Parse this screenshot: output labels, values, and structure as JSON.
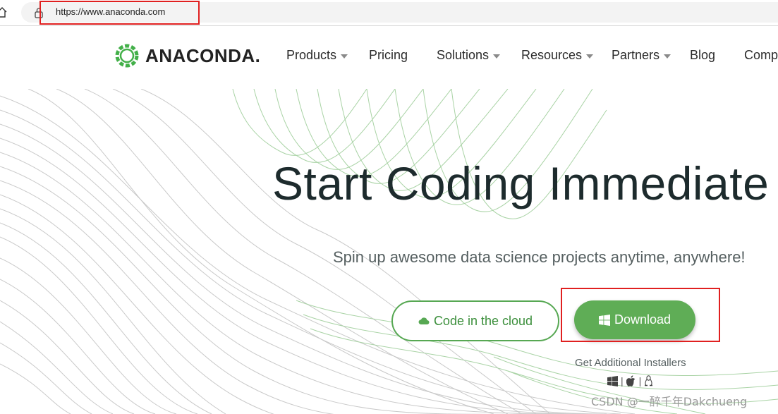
{
  "browser": {
    "url": "https://www.anaconda.com"
  },
  "nav": {
    "logo_text": "ANACONDA.",
    "items": [
      {
        "label": "Products",
        "has_dropdown": true
      },
      {
        "label": "Pricing",
        "has_dropdown": false
      },
      {
        "label": "Solutions",
        "has_dropdown": true
      },
      {
        "label": "Resources",
        "has_dropdown": true
      },
      {
        "label": "Partners",
        "has_dropdown": true
      },
      {
        "label": "Blog",
        "has_dropdown": false
      },
      {
        "label": "Comp",
        "has_dropdown": false
      }
    ]
  },
  "hero": {
    "title": "Start Coding Immediate",
    "subtitle": "Spin up awesome data science projects anytime, anywhere!",
    "cloud_button": "Code in the cloud",
    "download_button": "Download",
    "installers_label": "Get Additional Installers",
    "os_icons": [
      "windows-icon",
      "apple-icon",
      "linux-icon"
    ],
    "os_separator": "|"
  },
  "watermark": "CSDN @一醉千年Dakchueng",
  "colors": {
    "brand_green": "#5fad56",
    "highlight_red": "#e02020",
    "title_color": "#1d2b2d"
  }
}
